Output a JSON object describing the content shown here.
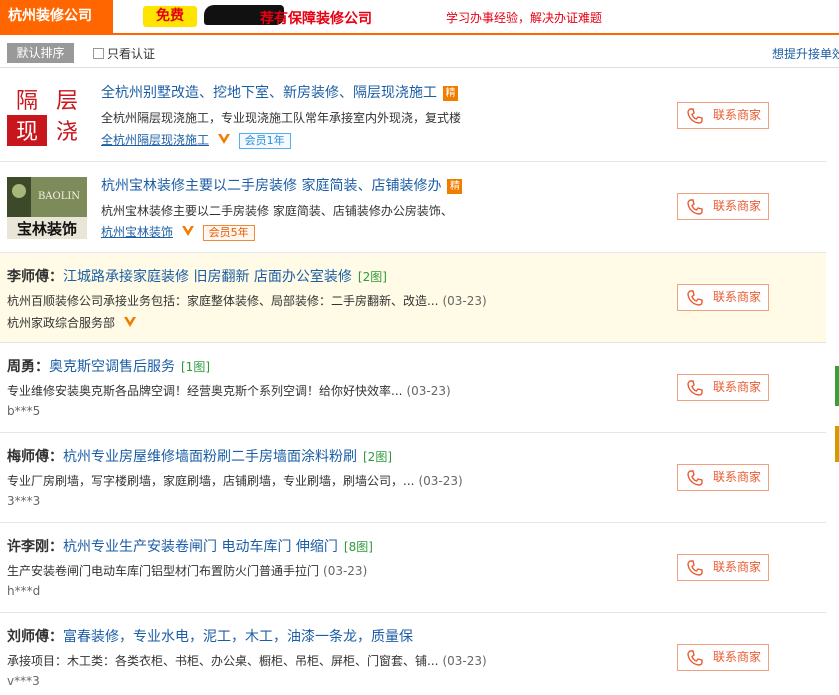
{
  "banner": {
    "city": "杭州装修公司",
    "free_label": "免费",
    "promo": "荐有保障装修公司",
    "slogan": "学习办事经验，解决办证难题"
  },
  "toolbar": {
    "sort_label": "默认排序",
    "verified_only_label": "只看认证",
    "verified_only_checked": false,
    "upsell_link": "想提升接单效"
  },
  "contact_label": "联系商家",
  "listings": [
    {
      "thumb_text": [
        "隔",
        "层",
        "现",
        "浇"
      ],
      "title": "全杭州别墅改造、挖地下室、新房装修、隔层现浇施工",
      "badge": "精",
      "desc": "全杭州隔层现浇施工，专业现浇施工队常年承接室内外现浇，复式楼",
      "shop": "全杭州隔层现浇施工",
      "member": "会员1年"
    },
    {
      "thumb_text": [
        "BAOLIN",
        "宝林装饰"
      ],
      "title": "杭州宝林装修主要以二手房装修 家庭简装、店铺装修办",
      "badge": "精",
      "desc": "杭州宝林装修主要以二手房装修 家庭简装、店铺装修办公房装饰、",
      "shop": "杭州宝林装饰",
      "member": "会员5年"
    },
    {
      "who": "李师傅",
      "title": "江城路承接家庭装修 旧房翻新 店面办公室装修",
      "pics": "[2图]",
      "desc": "杭州百顺装修公司承接业务包括：家庭整体装修、局部装修：二手房翻新、改造...",
      "date": "(03-23)",
      "user": "杭州家政综合服务部"
    },
    {
      "who": "周勇",
      "title": "奥克斯空调售后服务",
      "pics": "[1图]",
      "desc": "专业维修安装奥克斯各品牌空调！经营奥克斯个系列空调！给你好快效率...",
      "date": "(03-23)",
      "user": "b***5"
    },
    {
      "who": "梅师傅",
      "title": "杭州专业房屋维修墙面粉刷二手房墙面涂料粉刷",
      "pics": "[2图]",
      "desc": "专业厂房刷墙，写字楼刷墙，家庭刷墙，店铺刷墙，专业刷墙，刷墙公司，...",
      "date": "(03-23)",
      "user": "3***3"
    },
    {
      "who": "许李刚",
      "title": "杭州专业生产安装卷闸门 电动车库门 伸缩门",
      "pics": "[8图]",
      "desc": "生产安装卷闸门电动车库门铝型材门布置防火门普通手拉门",
      "date": "(03-23)",
      "user": "h***d"
    },
    {
      "who": "刘师傅",
      "title": "富春装修，专业水电，泥工，木工，油漆一条龙，质量保",
      "pics": "",
      "desc": "承接项目：木工类：各类衣柜、书柜、办公桌、橱柜、吊柜、屏柜、门窗套、铺...",
      "date": "(03-23)",
      "user": "v***3"
    }
  ],
  "colors": {
    "brand_orange": "#ff6600",
    "link_blue": "#1c5ea5",
    "highlight_bg": "#fffbe6",
    "pics_green": "#2e9a3c",
    "contact_red": "#e85a30"
  },
  "icons": [
    "phone-icon",
    "verified-v-icon",
    "checkbox-icon"
  ]
}
